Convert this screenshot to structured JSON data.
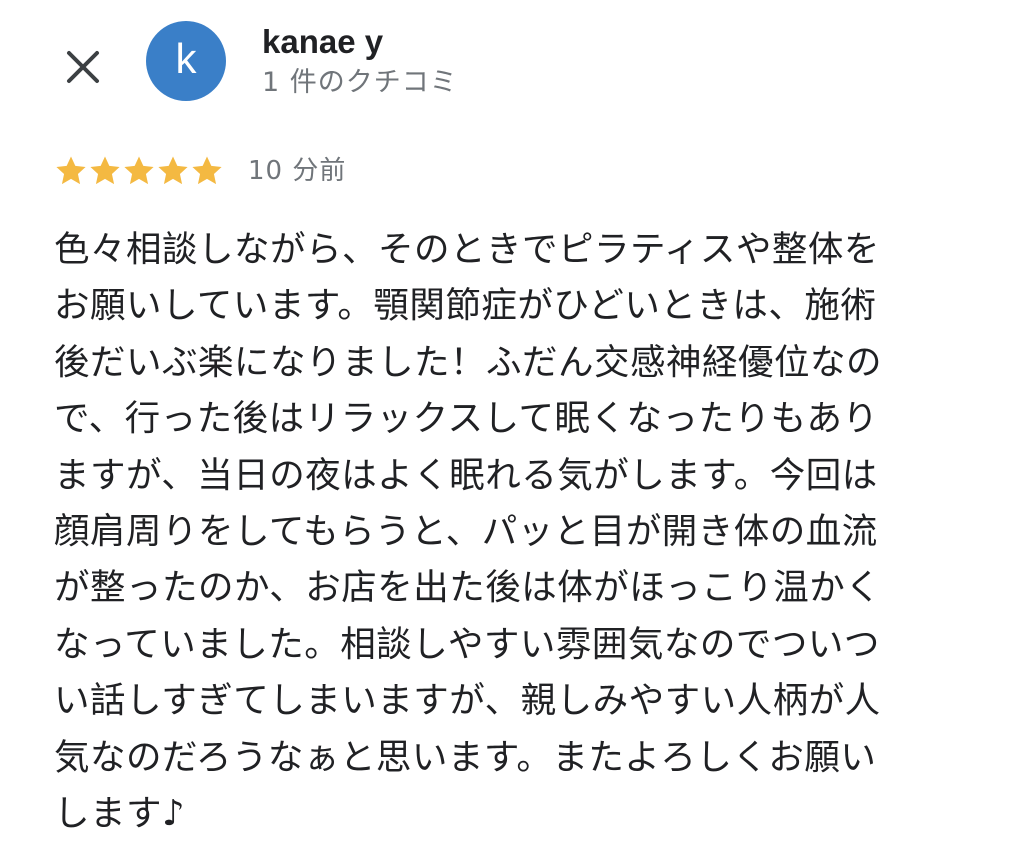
{
  "colors": {
    "avatar_background": "#3a7fc8",
    "star_fill": "#f4b942",
    "close_icon": "#3c4043"
  },
  "review": {
    "close_icon": "close-icon",
    "avatar_letter": "k",
    "user_name": "kanae y",
    "review_count": "1 件のクチコミ",
    "rating": 5,
    "rating_max": 5,
    "star_icon": "star-icon",
    "time": "10 分前",
    "text_lines": [
      "色々相談しながら、そのときでピラティスや整体を",
      "お願いしています。顎関節症がひどいときは、施術",
      "後だいぶ楽になりました！ふだん交感神経優位なの",
      "で、行った後はリラックスして眠くなったりもあり",
      "ますが、当日の夜はよく眠れる気がします。今回は",
      "顔肩周りをしてもらうと、パッと目が開き体の血流",
      "が整ったのか、お店を出た後は体がほっこり温かく",
      "なっていました。相談しやすい雰囲気なのでついつ",
      "い話しすぎてしまいますが、親しみやすい人柄が人",
      "気なのだろうなぁと思います。またよろしくお願い",
      "します♪"
    ]
  }
}
